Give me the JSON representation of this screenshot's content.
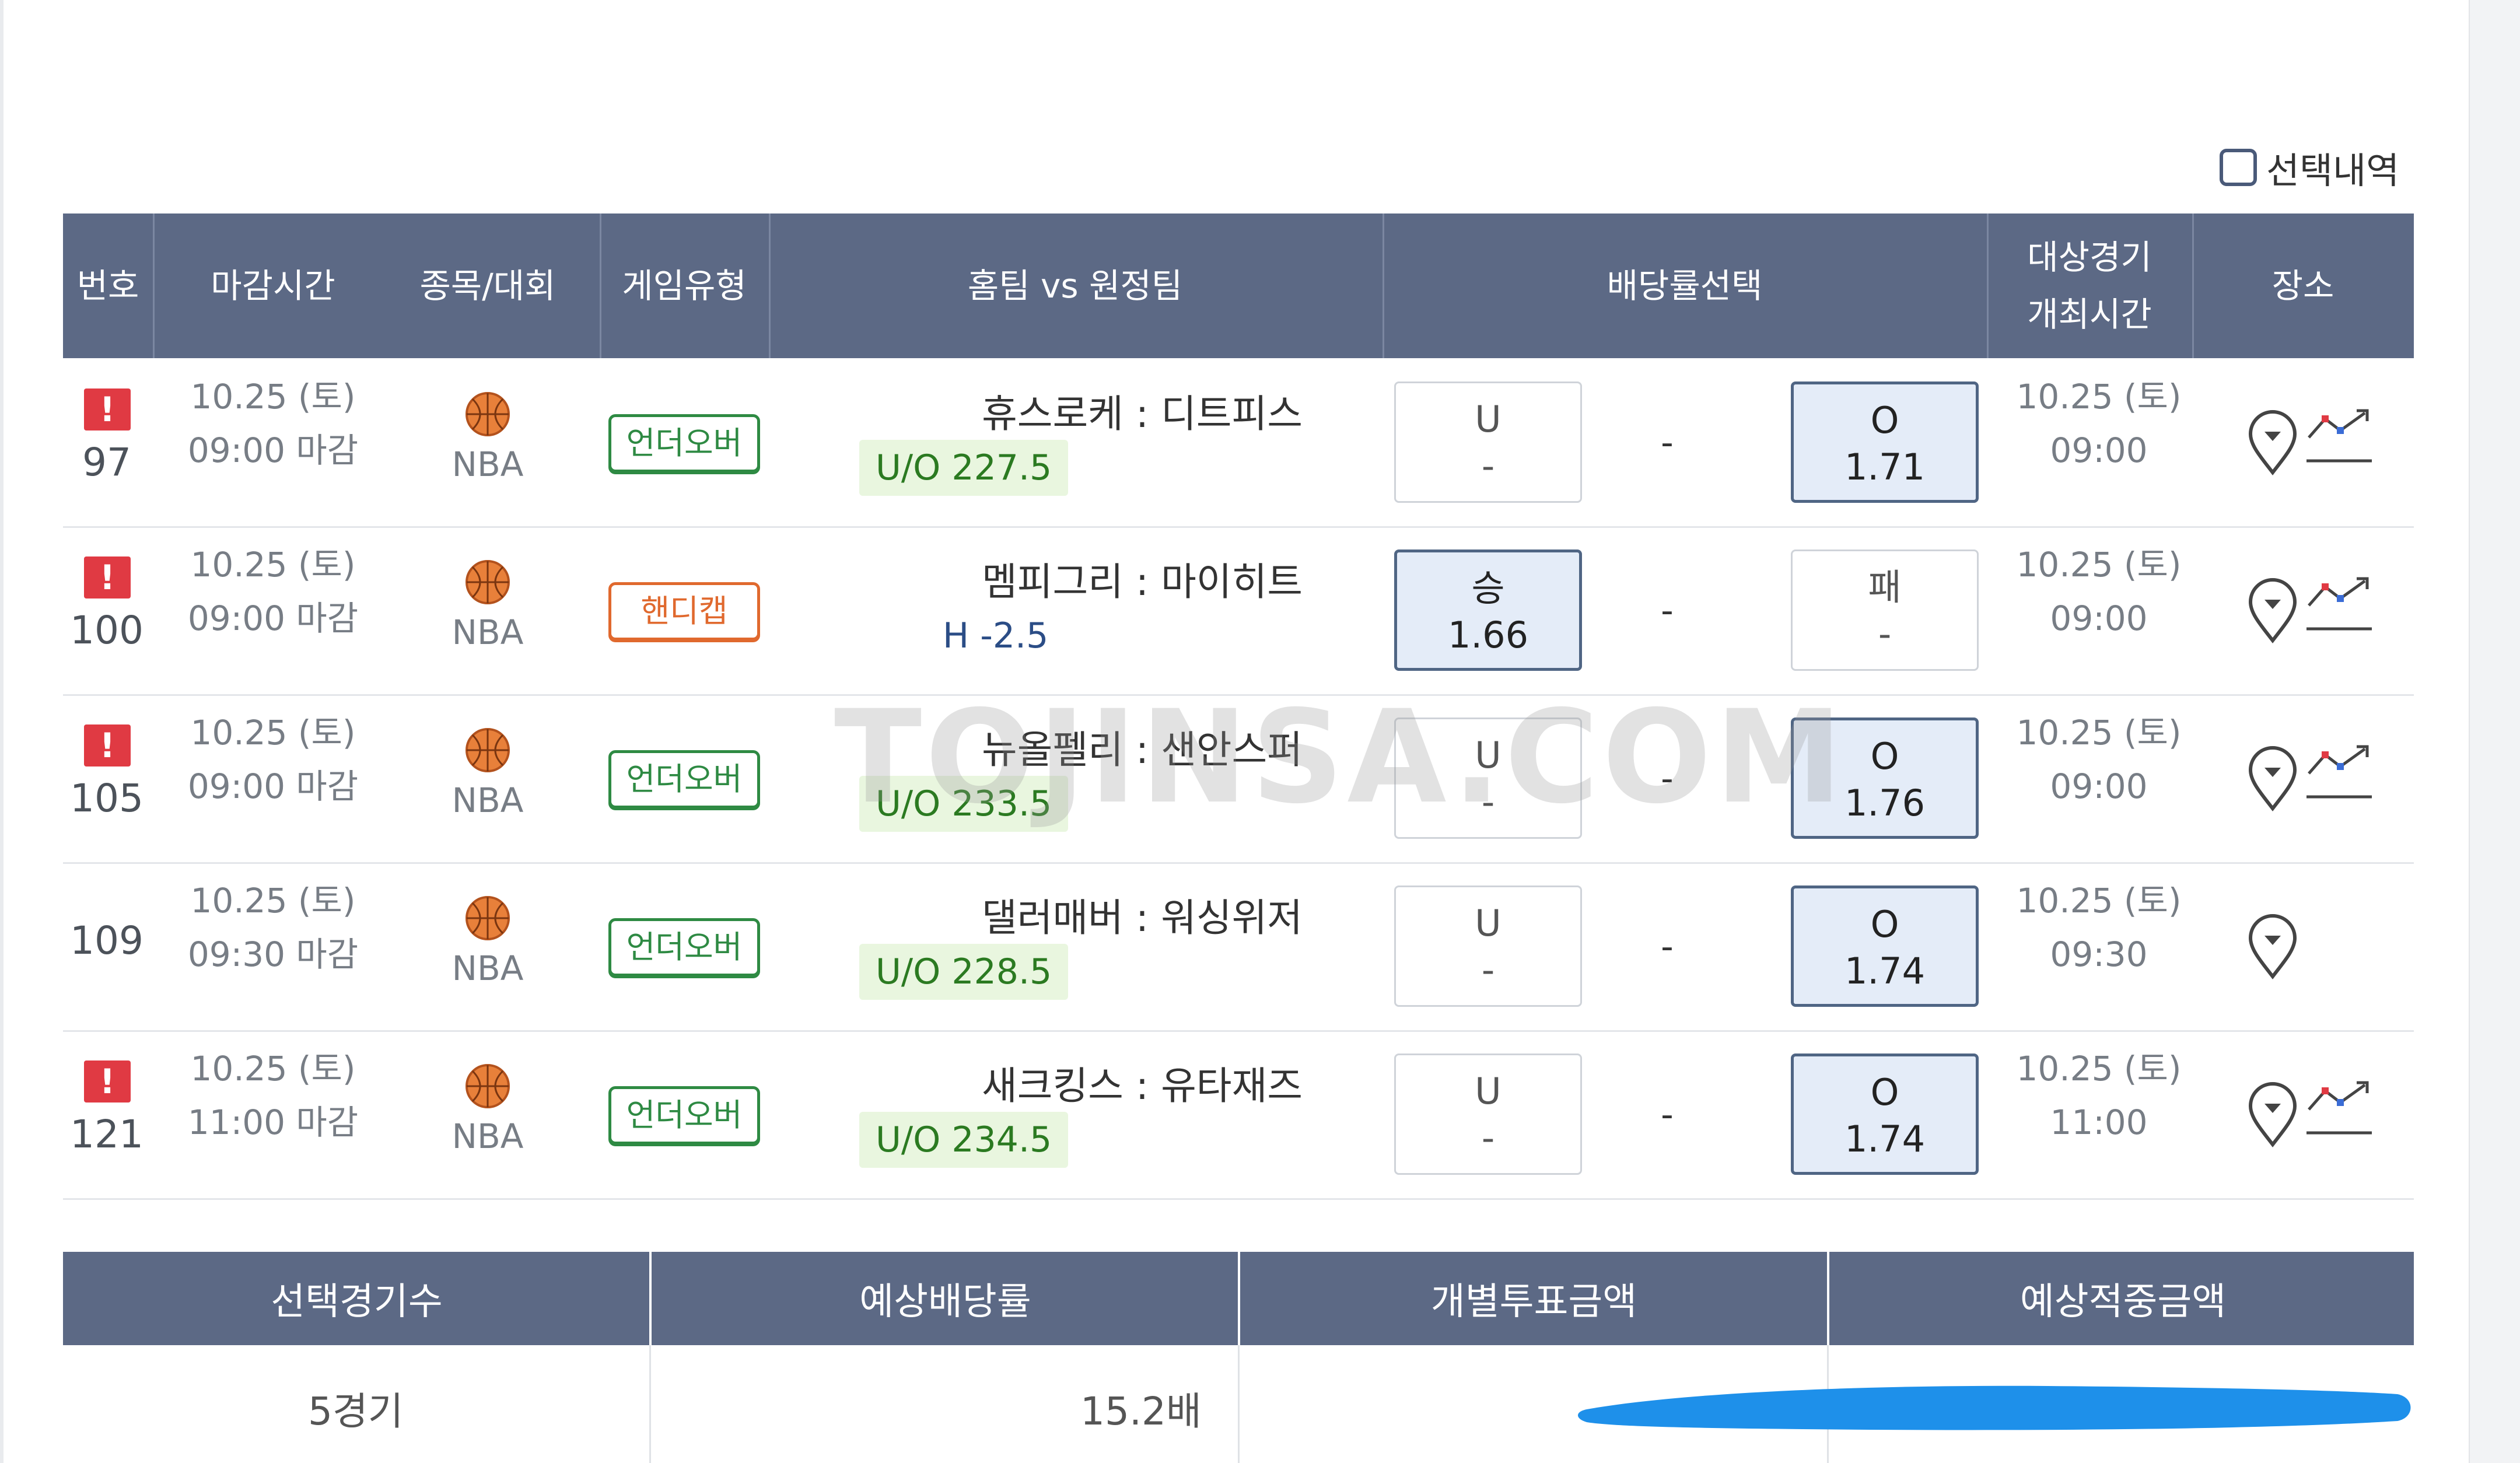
{
  "select_history_label": "선택내역",
  "table": {
    "headers": {
      "number": "번호",
      "deadline": "마감시간",
      "sport": "종목/대회",
      "game_type": "게임유형",
      "matchup": "홈팀 vs 원정팀",
      "odds": "배당률선택",
      "start_line1": "대상경기",
      "start_line2": "개최시간",
      "venue": "장소"
    },
    "rows": [
      {
        "alert": "!",
        "number": "97",
        "deadline_date": "10.25 (토)",
        "deadline_time": "09:00 마감",
        "sport": "NBA",
        "game_type": "언더오버",
        "teams": "휴스로케 : 디트피스",
        "line": "U/O 227.5",
        "home_label": "U",
        "home_value": "-",
        "draw": "-",
        "away_label": "O",
        "away_value": "1.71",
        "start_date": "10.25 (토)",
        "start_time": "09:00"
      },
      {
        "alert": "!",
        "number": "100",
        "deadline_date": "10.25 (토)",
        "deadline_time": "09:00 마감",
        "sport": "NBA",
        "game_type": "핸디캡",
        "teams": "멤피그리 : 마이히트",
        "line": "H -2.5",
        "home_label": "승",
        "home_value": "1.66",
        "draw": "-",
        "away_label": "패",
        "away_value": "-",
        "start_date": "10.25 (토)",
        "start_time": "09:00"
      },
      {
        "alert": "!",
        "number": "105",
        "deadline_date": "10.25 (토)",
        "deadline_time": "09:00 마감",
        "sport": "NBA",
        "game_type": "언더오버",
        "teams": "뉴올펠리 : 샌안스퍼",
        "line": "U/O 233.5",
        "home_label": "U",
        "home_value": "-",
        "draw": "-",
        "away_label": "O",
        "away_value": "1.76",
        "start_date": "10.25 (토)",
        "start_time": "09:00"
      },
      {
        "number": "109",
        "deadline_date": "10.25 (토)",
        "deadline_time": "09:30 마감",
        "sport": "NBA",
        "game_type": "언더오버",
        "teams": "댈러매버 : 워싱위저",
        "line": "U/O 228.5",
        "home_label": "U",
        "home_value": "-",
        "draw": "-",
        "away_label": "O",
        "away_value": "1.74",
        "start_date": "10.25 (토)",
        "start_time": "09:30"
      },
      {
        "alert": "!",
        "number": "121",
        "deadline_date": "10.25 (토)",
        "deadline_time": "11:00 마감",
        "sport": "NBA",
        "game_type": "언더오버",
        "teams": "새크킹스 : 유타재즈",
        "line": "U/O 234.5",
        "home_label": "U",
        "home_value": "-",
        "draw": "-",
        "away_label": "O",
        "away_value": "1.74",
        "start_date": "10.25 (토)",
        "start_time": "11:00"
      }
    ]
  },
  "summary": {
    "headers": [
      "선택경기수",
      "예상배당률",
      "개별투표금액",
      "예상적중금액"
    ],
    "games": "5경기",
    "odds": "15.2배"
  },
  "watermark": "TOJINSA.COM",
  "colors": {
    "header_bg": "#5c6985",
    "alert_red": "#e03a43",
    "over_under_green": "#2e8a43",
    "handicap_orange": "#e0692e",
    "selected_odds_bg": "#e4ecf8",
    "redaction_blue": "#1e90ea"
  },
  "icons": [
    "basketball-icon",
    "location-pin-icon",
    "trend-chart-icon"
  ]
}
